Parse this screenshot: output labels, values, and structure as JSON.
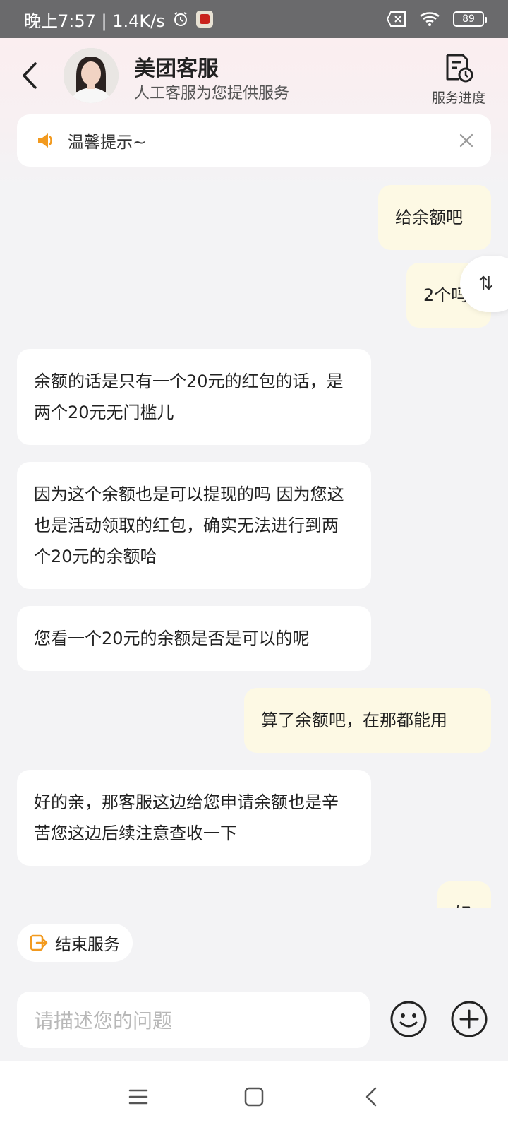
{
  "status_bar": {
    "time": "晚上7:57 | 1.4K/s",
    "battery": "89",
    "icons": [
      "alarm-icon",
      "app-notification-icon",
      "sim-off-icon",
      "wifi-icon",
      "battery-icon"
    ]
  },
  "header": {
    "title": "美团客服",
    "subtitle": "人工客服为您提供服务",
    "service_progress_label": "服务进度"
  },
  "notice": {
    "text": "温馨提示~"
  },
  "messages": [
    {
      "from": "user",
      "text": "给余额吧"
    },
    {
      "from": "user",
      "text": "2个吗"
    },
    {
      "from": "agent",
      "text": "余额的话是只有一个20元的红包的话，是两个20元无门槛儿"
    },
    {
      "from": "agent",
      "text": "因为这个余额也是可以提现的吗  因为您这也是活动领取的红包，确实无法进行到两个20元的余额哈"
    },
    {
      "from": "agent",
      "text": "您看一个20元的余额是否是可以的呢"
    },
    {
      "from": "user",
      "text": "算了余额吧，在那都能用"
    },
    {
      "from": "agent",
      "text": "好的亲，那客服这边给您申请余额也是辛苦您这边后续注意查收一下"
    },
    {
      "from": "user",
      "text": "好"
    }
  ],
  "side_handle": {
    "label": "⇅"
  },
  "actions": {
    "end_service_label": "结束服务"
  },
  "composer": {
    "placeholder": "请描述您的问题"
  },
  "colors": {
    "user_bubble": "#fdf9e4",
    "agent_bubble": "#ffffff",
    "accent_orange": "#f29a1f"
  }
}
